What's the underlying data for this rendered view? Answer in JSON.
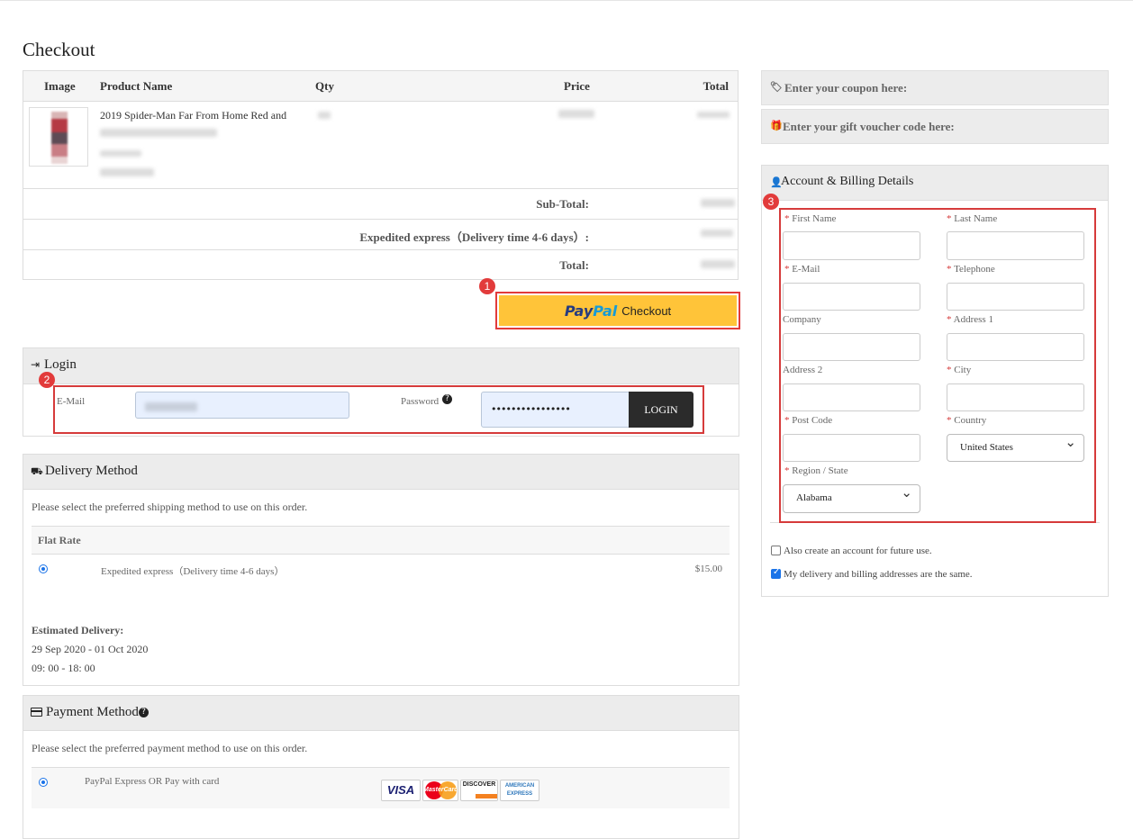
{
  "page": {
    "title": "Checkout"
  },
  "cart": {
    "columns": {
      "image": "Image",
      "product_name": "Product Name",
      "qty": "Qty",
      "price": "Price",
      "total": "Total"
    },
    "item": {
      "name": "2019 Spider-Man Far From Home Red and"
    },
    "summary": [
      {
        "label": "Sub-Total:"
      },
      {
        "label": "Expedited express（Delivery time 4-6 days）:"
      },
      {
        "label": "Total:"
      }
    ]
  },
  "paypal": {
    "brand_pay": "Pay",
    "brand_pal": "Pal",
    "checkout_label": "Checkout",
    "badge": "1"
  },
  "login": {
    "title": "Login",
    "badge": "2",
    "email_label": "E-Mail",
    "password_label": "Password",
    "password_value": "••••••••••••••••",
    "button_label": "LOGIN"
  },
  "delivery": {
    "title": "Delivery Method",
    "instruction": "Please select the preferred shipping method to use on this order.",
    "group": "Flat Rate",
    "option_label": "Expedited express（Delivery time 4-6 days）",
    "option_price": "$15.00",
    "estimated_label": "Estimated Delivery:",
    "estimated_dates": "29 Sep 2020 - 01 Oct 2020",
    "estimated_hours": "09: 00 - 18: 00"
  },
  "payment": {
    "title": "Payment Method",
    "instruction": "Please select the preferred payment method to use on this order.",
    "option_label": "PayPal Express OR Pay with card",
    "cards": {
      "visa": "VISA",
      "mastercard": "MasterCard",
      "discover": "DISCOVER",
      "amex_line1": "AMERICAN",
      "amex_line2": "EXPRESS"
    }
  },
  "coupon": {
    "label": "Enter your coupon here:"
  },
  "voucher": {
    "label": "Enter your gift voucher code here:"
  },
  "account": {
    "title": "Account & Billing Details",
    "badge": "3",
    "fields": {
      "first_name": "First Name",
      "last_name": "Last Name",
      "email": "E-Mail",
      "telephone": "Telephone",
      "company": "Company",
      "address1": "Address 1",
      "address2": "Address 2",
      "city": "City",
      "postcode": "Post Code",
      "country": "Country",
      "region": "Region / State"
    },
    "required_mark": "*",
    "country_value": "United States",
    "region_value": "Alabama",
    "create_account_label": "Also create an account for future use.",
    "same_address_label": "My delivery and billing addresses are the same."
  },
  "colors": {
    "accent_red": "#d63b3b",
    "paypal_yellow": "#ffc439",
    "paypal_blue": "#253b80",
    "radio_blue": "#1a73e8"
  }
}
